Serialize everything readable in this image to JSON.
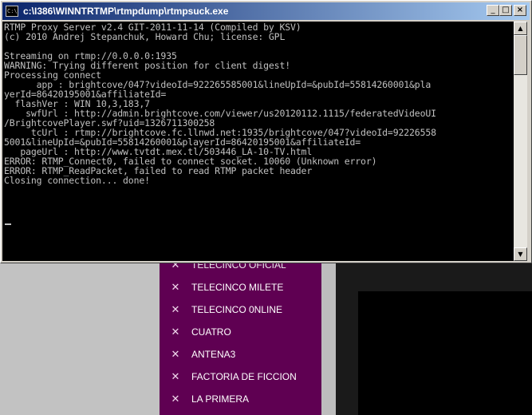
{
  "console": {
    "title": "c:\\I386\\WINNTRTMP\\rtmpdump\\rtmpsuck.exe",
    "icon_text": "C:\\",
    "buttons": {
      "minimize": "_",
      "maximize": "□",
      "close": "×"
    },
    "lines": [
      "RTMP Proxy Server v2.4 GIT-2011-11-14 (Compiled by KSV)",
      "(c) 2010 Andrej Stepanchuk, Howard Chu; license: GPL",
      "",
      "Streaming on rtmp://0.0.0.0:1935",
      "WARNING: Trying different position for client digest!",
      "Processing connect",
      "      app : brightcove/047?videoId=922265585001&lineUpId=&pubId=55814260001&pla",
      "yerId=86420195001&affiliateId=",
      "  flashVer : WIN 10,3,183,7",
      "    swfUrl : http://admin.brightcove.com/viewer/us20120112.1115/federatedVideoUI",
      "/BrightcovePlayer.swf?uid=1326711300258",
      "     tcUrl : rtmp://brightcove.fc.llnwd.net:1935/brightcove/047?videoId=92226558",
      "5001&lineUpId=&pubId=55814260001&playerId=86420195001&affiliateId=",
      "   pageUrl : http://www.tvtdt.mex.tl/503446_LA-10-TV.html",
      "ERROR: RTMP_Connect0, failed to connect socket. 10060 (Unknown error)",
      "ERROR: RTMP_ReadPacket, failed to read RTMP packet header",
      "Closing connection... done!"
    ],
    "scroll": {
      "up": "▲",
      "down": "▼"
    }
  },
  "menu": {
    "bullet": "✕",
    "items": [
      {
        "label": "TELECINCO OFICIAL"
      },
      {
        "label": "TELECINCO MILETE"
      },
      {
        "label": "TELECINCO 0NLINE"
      },
      {
        "label": "CUATRO"
      },
      {
        "label": "ANTENA3"
      },
      {
        "label": "FACTORIA DE FICCION"
      },
      {
        "label": "LA PRIMERA"
      }
    ]
  },
  "colors": {
    "title_gradient_start": "#0a246a",
    "title_gradient_end": "#a6caf0",
    "console_bg": "#000000",
    "console_text": "#c0c0c0",
    "menu_bg": "#5f0052"
  }
}
